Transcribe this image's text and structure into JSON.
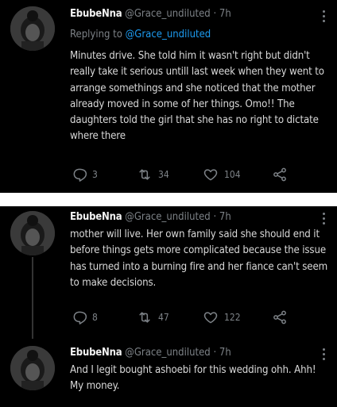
{
  "tweets": [
    {
      "name": "EbubeNna",
      "handle": "@Grace_undiluted",
      "separator": "·",
      "time": "7h",
      "replying_label": "Replying to",
      "replying_handle": "@Grace_undiluted",
      "text": "Minutes drive. She told him it wasn't right but didn't really take it serious untill last week when they went to arrange somethings and she noticed that the mother already moved in some of her things. Omo!! The daughters told the girl that she has no right to dictate where there",
      "reply_count": "3",
      "retweet_count": "34",
      "like_count": "104"
    },
    {
      "name": "EbubeNna",
      "handle": "@Grace_undiluted",
      "separator": "·",
      "time": "7h",
      "text": "mother will live. Her own family said she should end it before things gets more complicated because the issue has turned into a burning fire and her fiance can't seem to make decisions.",
      "reply_count": "8",
      "retweet_count": "47",
      "like_count": "122"
    },
    {
      "name": "EbubeNna",
      "handle": "@Grace_undiluted",
      "separator": "·",
      "time": "7h",
      "text": "And I legit bought ashoebi for this wedding ohh. Ahh!  My money."
    }
  ],
  "icons": {
    "reply": "reply-icon",
    "retweet": "retweet-icon",
    "like": "heart-icon",
    "share": "share-icon",
    "more": "more-caret-icon"
  },
  "colors": {
    "background": "#000000",
    "text": "#d9d9d9",
    "muted": "#7d8287",
    "link": "#1d9bf0",
    "separator": "#ffffff"
  }
}
